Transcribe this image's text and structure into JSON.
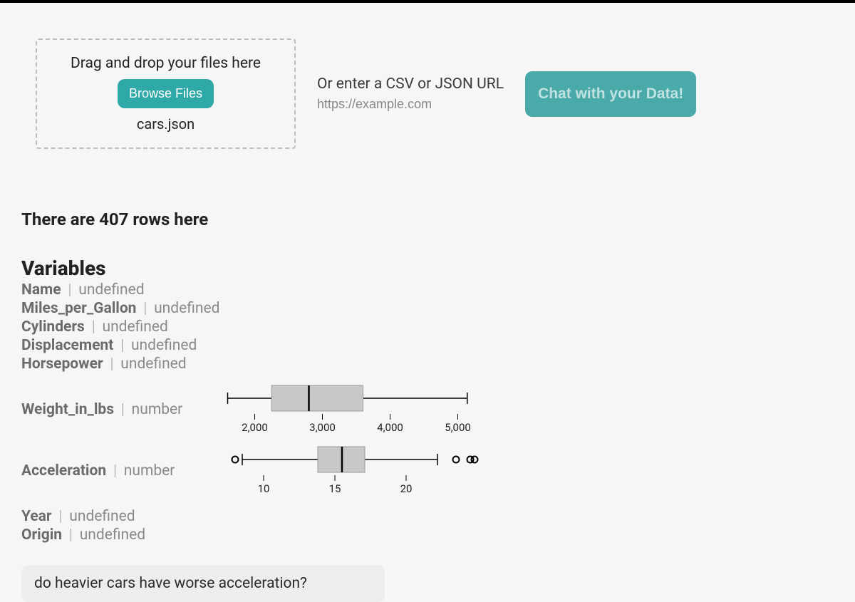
{
  "dropzone": {
    "prompt": "Drag and drop your files here",
    "browse_label": "Browse Files",
    "filename": "cars.json"
  },
  "url_entry": {
    "label": "Or enter a CSV or JSON URL",
    "placeholder": "https://example.com"
  },
  "chat_button": "Chat with your Data!",
  "row_count_text": "There are 407 rows here",
  "variables_heading": "Variables",
  "variables": [
    {
      "name": "Name",
      "type": "undefined"
    },
    {
      "name": "Miles_per_Gallon",
      "type": "undefined"
    },
    {
      "name": "Cylinders",
      "type": "undefined"
    },
    {
      "name": "Displacement",
      "type": "undefined"
    },
    {
      "name": "Horsepower",
      "type": "undefined"
    },
    {
      "name": "Weight_in_lbs",
      "type": "number"
    },
    {
      "name": "Acceleration",
      "type": "number"
    },
    {
      "name": "Year",
      "type": "undefined"
    },
    {
      "name": "Origin",
      "type": "undefined"
    }
  ],
  "chart_data": [
    {
      "type": "boxplot",
      "variable": "Weight_in_lbs",
      "axis_ticks": [
        2000,
        3000,
        4000,
        5000
      ],
      "whisker_low": 1600,
      "q1": 2250,
      "median": 2800,
      "q3": 3600,
      "whisker_high": 5140,
      "outliers": [],
      "xlim": [
        1500,
        5500
      ]
    },
    {
      "type": "boxplot",
      "variable": "Acceleration",
      "axis_ticks": [
        10,
        15,
        20
      ],
      "whisker_low": 8.5,
      "q1": 13.8,
      "median": 15.5,
      "q3": 17.1,
      "whisker_high": 22.2,
      "outliers": [
        8.0,
        23.5,
        24.5,
        24.8
      ],
      "xlim": [
        7,
        26
      ]
    }
  ],
  "query": "do heavier cars have worse acceleration?",
  "colors": {
    "accent": "#2fa8a8",
    "box_fill": "#c8c8c8"
  }
}
